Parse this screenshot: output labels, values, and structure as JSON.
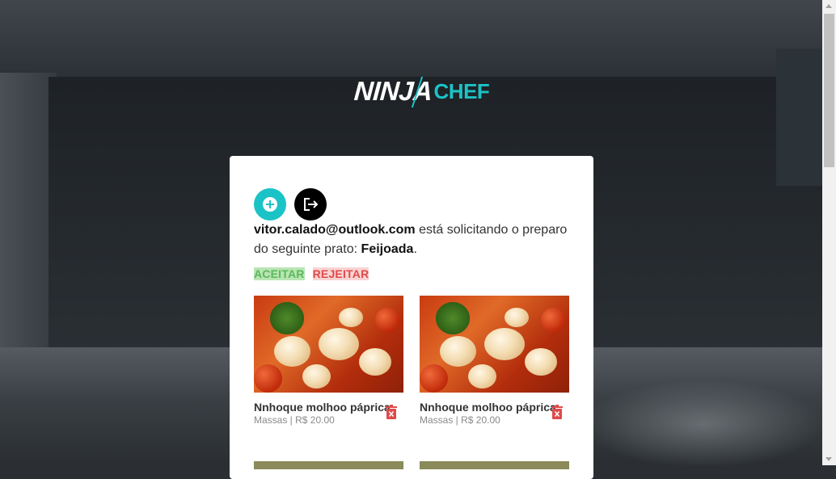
{
  "brand": {
    "logo_ninja": "NINJA",
    "logo_chef": "CHEF"
  },
  "toolbar": {
    "add_icon": "plus-circle-icon",
    "logout_icon": "logout-icon"
  },
  "request": {
    "email": "vitor.calado@outlook.com",
    "message": " está solicitando o preparo do seguinte prato: ",
    "dish": "Feijoada",
    "end": "."
  },
  "actions": {
    "accept_label": "ACEITAR",
    "reject_label": "REJEITAR"
  },
  "dishes": [
    {
      "name": "Nnhoque molhoo páprica",
      "meta": "Massas | R$ 20.00"
    },
    {
      "name": "Nnhoque molhoo páprica",
      "meta": "Massas | R$ 20.00"
    }
  ],
  "colors": {
    "accent": "#1bc3c6",
    "accept": "#5cb85c",
    "reject": "#e04a4a"
  }
}
